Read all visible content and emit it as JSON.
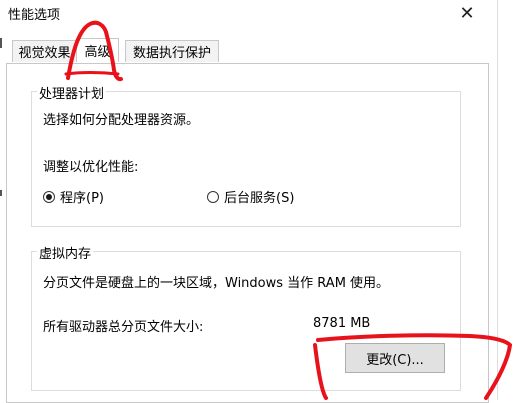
{
  "window": {
    "title": "性能选项",
    "close_glyph": "✕"
  },
  "tabs": [
    {
      "label": "视觉效果",
      "active": false
    },
    {
      "label": "高级",
      "active": true
    },
    {
      "label": "数据执行保护",
      "active": false
    }
  ],
  "processor_scheduling": {
    "title": "处理器计划",
    "description": "选择如何分配处理器资源。",
    "adjust_label": "调整以优化性能:",
    "options": [
      {
        "label": "程序(P)",
        "checked": true
      },
      {
        "label": "后台服务(S)",
        "checked": false
      }
    ]
  },
  "virtual_memory": {
    "title": "虚拟内存",
    "description": "分页文件是硬盘上的一块区域，Windows 当作 RAM 使用。",
    "total_label": "所有驱动器总分页文件大小:",
    "total_value": "8781 MB",
    "change_button": "更改(C)..."
  },
  "colors": {
    "annotation_red": "#e8121a",
    "accent": "#0078d7"
  }
}
